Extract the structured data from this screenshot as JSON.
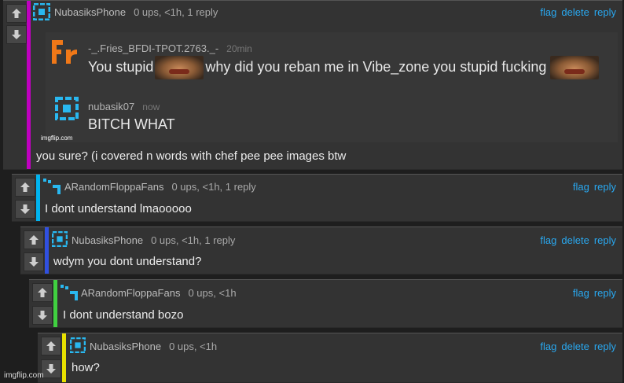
{
  "colors": {
    "link": "#29a8f0",
    "bar_magenta": "#c000c0",
    "bar_cyan": "#00b4f0",
    "bar_blue": "#3050e0",
    "bar_green": "#40d040",
    "bar_yellow": "#e8e000",
    "page_bg": "#1e1e1e",
    "comment_bg": "#333333"
  },
  "comments": [
    {
      "user": "NubasiksPhone",
      "meta": "0 ups, <1h, 1 reply",
      "actions": [
        "flag",
        "delete",
        "reply"
      ],
      "avatar_icon": "square-target-icon",
      "text": "you sure? (i covered n words with chef pee pee images btw",
      "embed": {
        "watermark": "imgflip.com",
        "msg1": {
          "avatar": "fr-logo-icon",
          "user": "-_.Fries_BFDI-TPOT.2763._-",
          "time": "20min",
          "text_a": "You stupid",
          "text_b": "why did you reban me in Vibe_zone you stupid fucking"
        },
        "msg2": {
          "avatar": "square-target-icon",
          "user": "nubasik07",
          "time": "now",
          "text": "BITCH WHAT"
        }
      }
    },
    {
      "user": "ARandomFloppaFans",
      "meta": "0 ups, <1h, 1 reply",
      "actions": [
        "flag",
        "reply"
      ],
      "avatar_icon": "corner-bracket-icon",
      "text": "I dont understand lmaooooo"
    },
    {
      "user": "NubasiksPhone",
      "meta": "0 ups, <1h, 1 reply",
      "actions": [
        "flag",
        "delete",
        "reply"
      ],
      "avatar_icon": "square-target-icon",
      "text": "wdym you dont understand?"
    },
    {
      "user": "ARandomFloppaFans",
      "meta": "0 ups, <1h",
      "actions": [
        "flag",
        "reply"
      ],
      "avatar_icon": "corner-bracket-icon",
      "text": "I dont understand bozo"
    },
    {
      "user": "NubasiksPhone",
      "meta": "0 ups, <1h",
      "actions": [
        "flag",
        "delete",
        "reply"
      ],
      "avatar_icon": "square-target-icon",
      "text": "how?"
    }
  ],
  "page_watermark": "imgflip.com"
}
